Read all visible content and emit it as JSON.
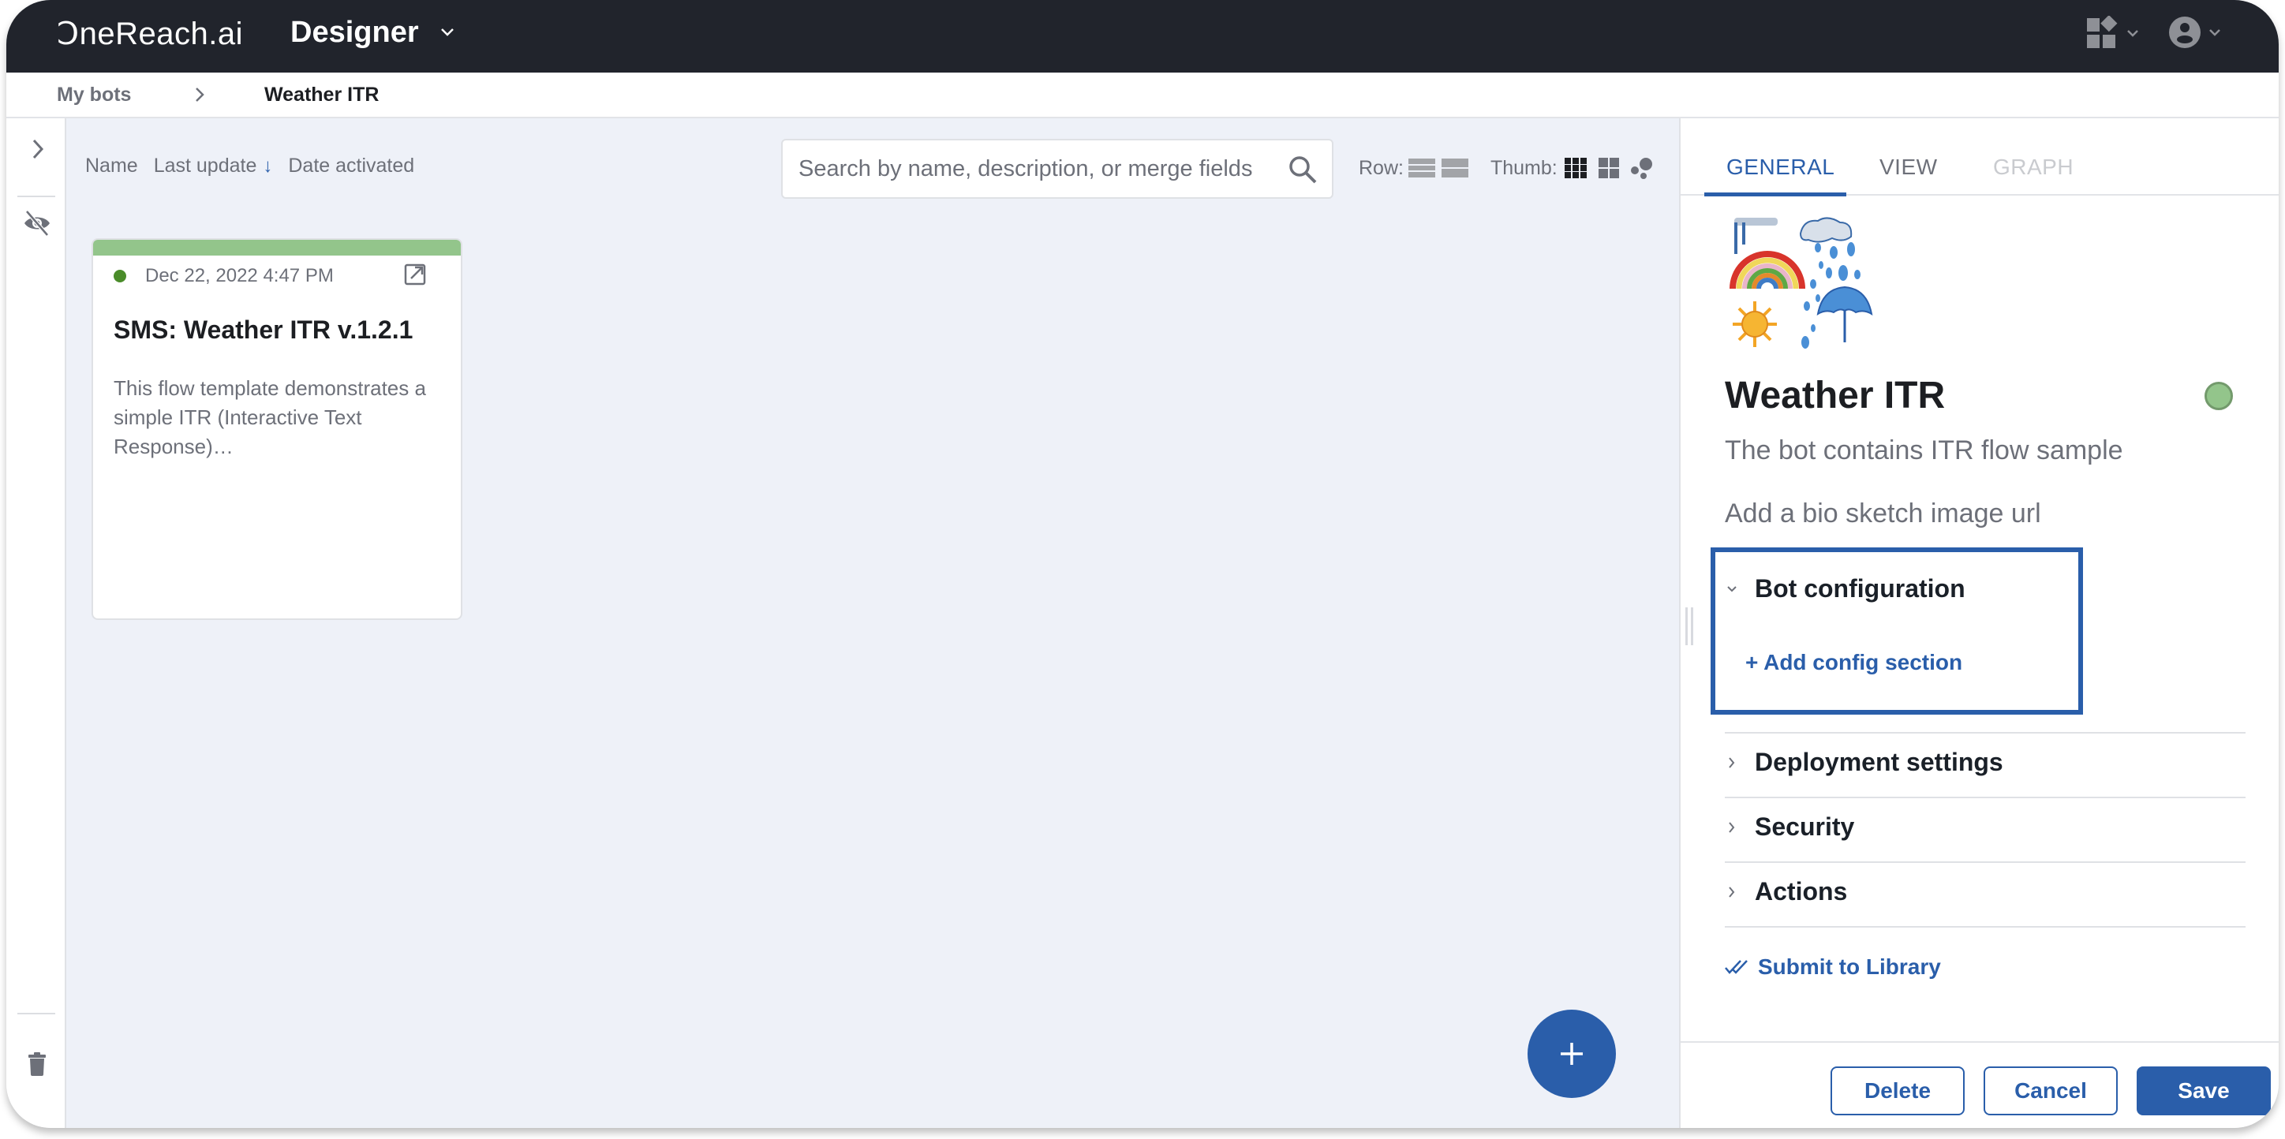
{
  "header": {
    "logo": "ↃneReach.ai",
    "app_name": "Designer",
    "app_menu_icon": "chevron-down-icon",
    "apps_icon": "apps-grid-icon",
    "user_icon": "account-circle-icon"
  },
  "breadcrumb": {
    "root": "My bots",
    "separator_icon": "chevron-right-icon",
    "current": "Weather ITR"
  },
  "sidebar": {
    "expand_icon": "chevron-right-icon",
    "hide_icon": "eye-off-icon",
    "trash_icon": "trash-icon"
  },
  "toolbar": {
    "sort_options": [
      {
        "label": "Name",
        "active": false
      },
      {
        "label": "Last update",
        "active": true,
        "direction": "desc"
      },
      {
        "label": "Date activated",
        "active": false
      }
    ],
    "sort_arrow": "↓",
    "search_placeholder": "Search by name, description, or merge fields",
    "search_value": "",
    "row_label": "Row:",
    "thumb_label": "Thumb:",
    "selected_view": "thumb-small-grid"
  },
  "cards": [
    {
      "status": "active",
      "status_color": "#4a8c2a",
      "updated": "Dec 22, 2022 4:47 PM",
      "title": "SMS: Weather ITR v.1.2.1",
      "description": "This flow template demonstrates a simple ITR (Interactive Text Response)…",
      "bar_color": "#93c58b"
    }
  ],
  "fab": {
    "label": "+"
  },
  "panel": {
    "tabs": [
      {
        "label": "GENERAL",
        "state": "active"
      },
      {
        "label": "VIEW",
        "state": "normal"
      },
      {
        "label": "GRAPH",
        "state": "disabled"
      }
    ],
    "bot_name": "Weather ITR",
    "status_color": "#93c58b",
    "description": "The bot contains ITR flow sample",
    "bio_placeholder": "Add a bio sketch image url",
    "sections": [
      {
        "label": "Bot configuration",
        "expanded": true
      },
      {
        "label": "Deployment settings",
        "expanded": false
      },
      {
        "label": "Security",
        "expanded": false
      },
      {
        "label": "Actions",
        "expanded": false
      }
    ],
    "add_config": "+ Add config section",
    "submit_library": "Submit to Library",
    "buttons": {
      "delete": "Delete",
      "cancel": "Cancel",
      "save": "Save"
    }
  },
  "colors": {
    "accent": "#2a5eaa",
    "header_bg": "#21242c",
    "canvas_bg": "#eef1f8"
  }
}
